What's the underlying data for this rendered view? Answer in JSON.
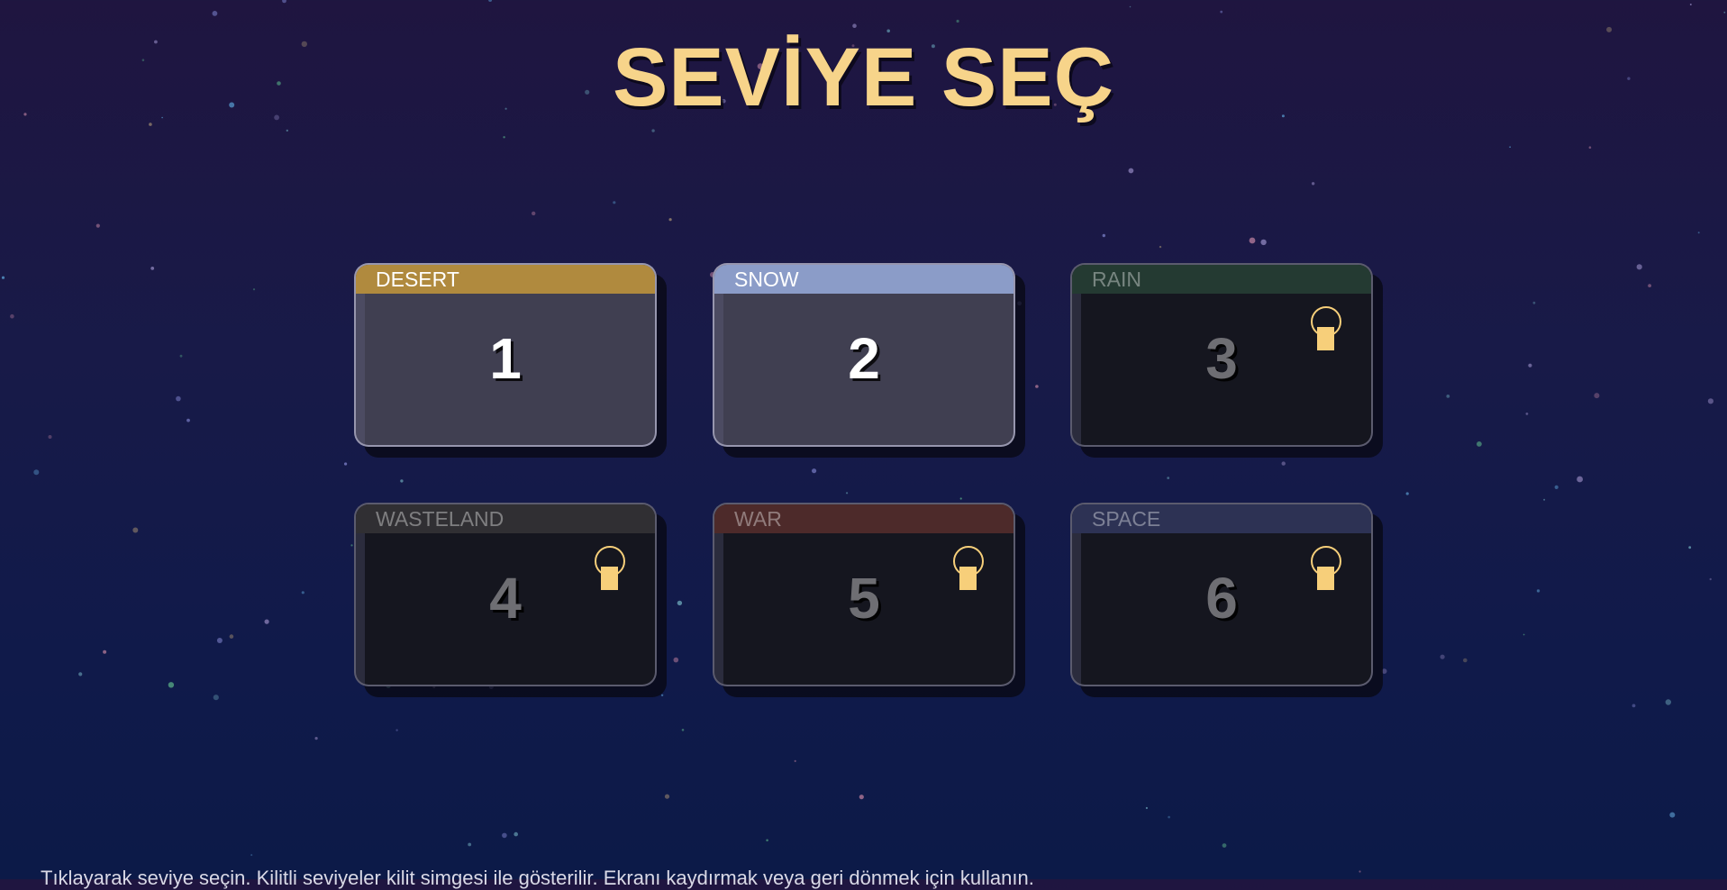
{
  "screen": {
    "title": "SEVİYE SEÇ",
    "footer_text": "Tıklayarak seviye seçin. Kilitli seviyeler kilit simgesi ile gösterilir. Ekranı kaydırmak veya geri dönmek için kullanın."
  },
  "colors": {
    "title": "#f7d48a",
    "lock": "#f7cf7a",
    "unlocked_card": "#403f51",
    "locked_card": "#15161f"
  },
  "levels": [
    {
      "number": "1",
      "name": "DESERT",
      "locked": false,
      "band_color": "#b08a3e",
      "lock_icon": ""
    },
    {
      "number": "2",
      "name": "SNOW",
      "locked": false,
      "band_color": "#8b9cc8",
      "lock_icon": ""
    },
    {
      "number": "3",
      "name": "RAIN",
      "locked": true,
      "band_color": "#243a32",
      "lock_icon": "padlock-icon"
    },
    {
      "number": "4",
      "name": "WASTELAND",
      "locked": true,
      "band_color": "#302f33",
      "lock_icon": "padlock-icon"
    },
    {
      "number": "5",
      "name": "WAR",
      "locked": true,
      "band_color": "#4d2a2a",
      "lock_icon": "padlock-icon"
    },
    {
      "number": "6",
      "name": "SPACE",
      "locked": true,
      "band_color": "#2d3254",
      "lock_icon": "padlock-icon"
    }
  ]
}
